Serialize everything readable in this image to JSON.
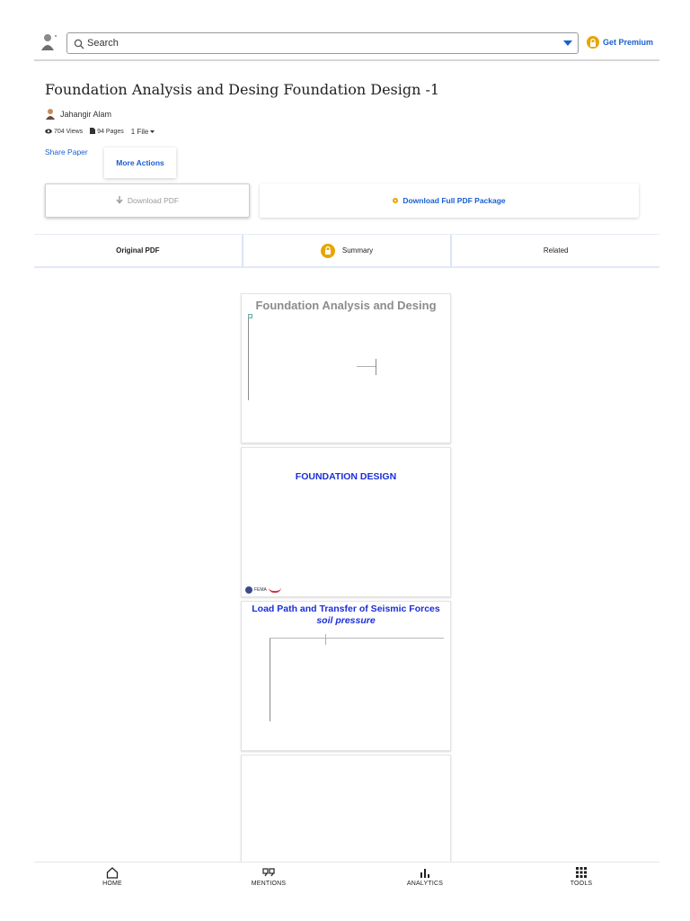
{
  "header": {
    "search_placeholder": "Search",
    "premium_label": "Get Premium"
  },
  "paper": {
    "title": "Foundation Analysis and Desing Foundation Design -1",
    "author": "Jahangir Alam",
    "views": "704 Views",
    "pages": "94 Pages",
    "files": "1 File",
    "share_label": "Share Paper",
    "more_actions_label": "More Actions"
  },
  "actions": {
    "download_pdf": "Download PDF",
    "download_package": "Download Full PDF Package"
  },
  "tabs": [
    {
      "label": "Original PDF",
      "active": true
    },
    {
      "label": "Summary",
      "locked": true
    },
    {
      "label": "Related"
    }
  ],
  "preview": {
    "page1_title": "Foundation Analysis and Desing",
    "page2_title": "FOUNDATION DESIGN",
    "page2_logo_text": "FEMA",
    "page3_title": "Load Path and Transfer of Seismic Forces",
    "page3_subtitle": "soil pressure"
  },
  "bottom_nav": [
    {
      "label": "HOME",
      "icon": "home-icon"
    },
    {
      "label": "MENTIONS",
      "icon": "quote-icon"
    },
    {
      "label": "ANALYTICS",
      "icon": "bar-chart-icon"
    },
    {
      "label": "TOOLS",
      "icon": "grid-icon"
    }
  ],
  "colors": {
    "accent": "#1a5fd1",
    "premium": "#e9a400",
    "slide_title_blue": "#1b2fd6"
  }
}
